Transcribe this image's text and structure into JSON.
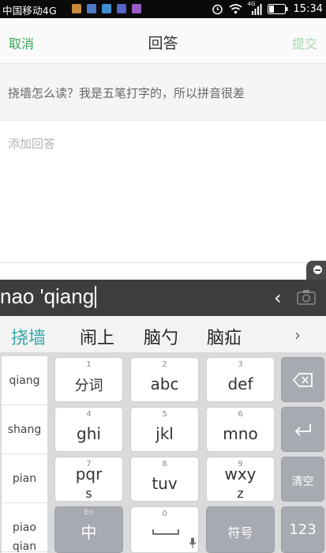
{
  "status": {
    "carrier": "中国移动4G",
    "network": "4G",
    "time": "15:34"
  },
  "header": {
    "cancel": "取消",
    "title": "回答",
    "submit": "提交"
  },
  "question": {
    "text": "挠墙怎么读？我是五笔打字的，所以拼音很差"
  },
  "answer": {
    "placeholder": "添加回答"
  },
  "ime": {
    "composing": "nao 'qiang",
    "candidates": [
      "挠墙",
      "闹上",
      "脑勺",
      "脑疝"
    ],
    "pinyin": [
      "qiang",
      "shang",
      "pian",
      "piao",
      "qian"
    ],
    "keys": {
      "k1": {
        "num": "1",
        "label": "分词"
      },
      "k2": {
        "num": "2",
        "label": "abc"
      },
      "k3": {
        "num": "3",
        "label": "def"
      },
      "k4": {
        "num": "4",
        "label": "ghi"
      },
      "k5": {
        "num": "5",
        "label": "jkl"
      },
      "k6": {
        "num": "6",
        "label": "mno"
      },
      "k7": {
        "num": "7",
        "label": "pqr",
        "sub": "s"
      },
      "k8": {
        "num": "8",
        "label": "tuv"
      },
      "k9": {
        "num": "9",
        "label": "wxy",
        "sub": "z"
      },
      "k0": {
        "num": "0"
      },
      "clear": "清空",
      "lang": {
        "top": "En",
        "label": "中"
      },
      "symbol": "符号",
      "num_mode": "123"
    }
  },
  "colors": {
    "accent_green": "#3aa65a",
    "candidate_teal": "#35a7a9"
  }
}
